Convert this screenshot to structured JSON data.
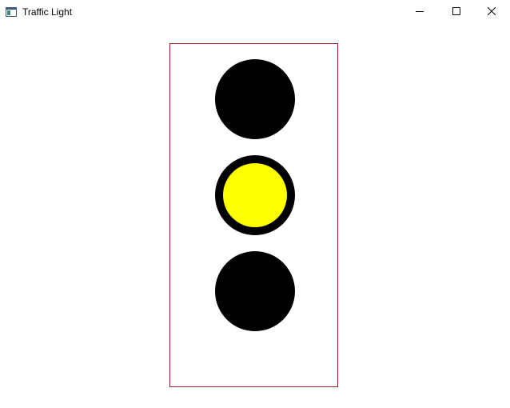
{
  "window": {
    "title": "Traffic Light",
    "icon": "app-window-icon",
    "controls": [
      "minimize-icon",
      "maximize-icon",
      "close-icon"
    ]
  },
  "traffic_light": {
    "frame_color": "#a0222c",
    "off_color": "#000000",
    "lamps": [
      {
        "name": "red",
        "on": false,
        "on_color": "#ff0000"
      },
      {
        "name": "yellow",
        "on": true,
        "on_color": "#ffff00"
      },
      {
        "name": "green",
        "on": false,
        "on_color": "#00ff00"
      }
    ]
  }
}
